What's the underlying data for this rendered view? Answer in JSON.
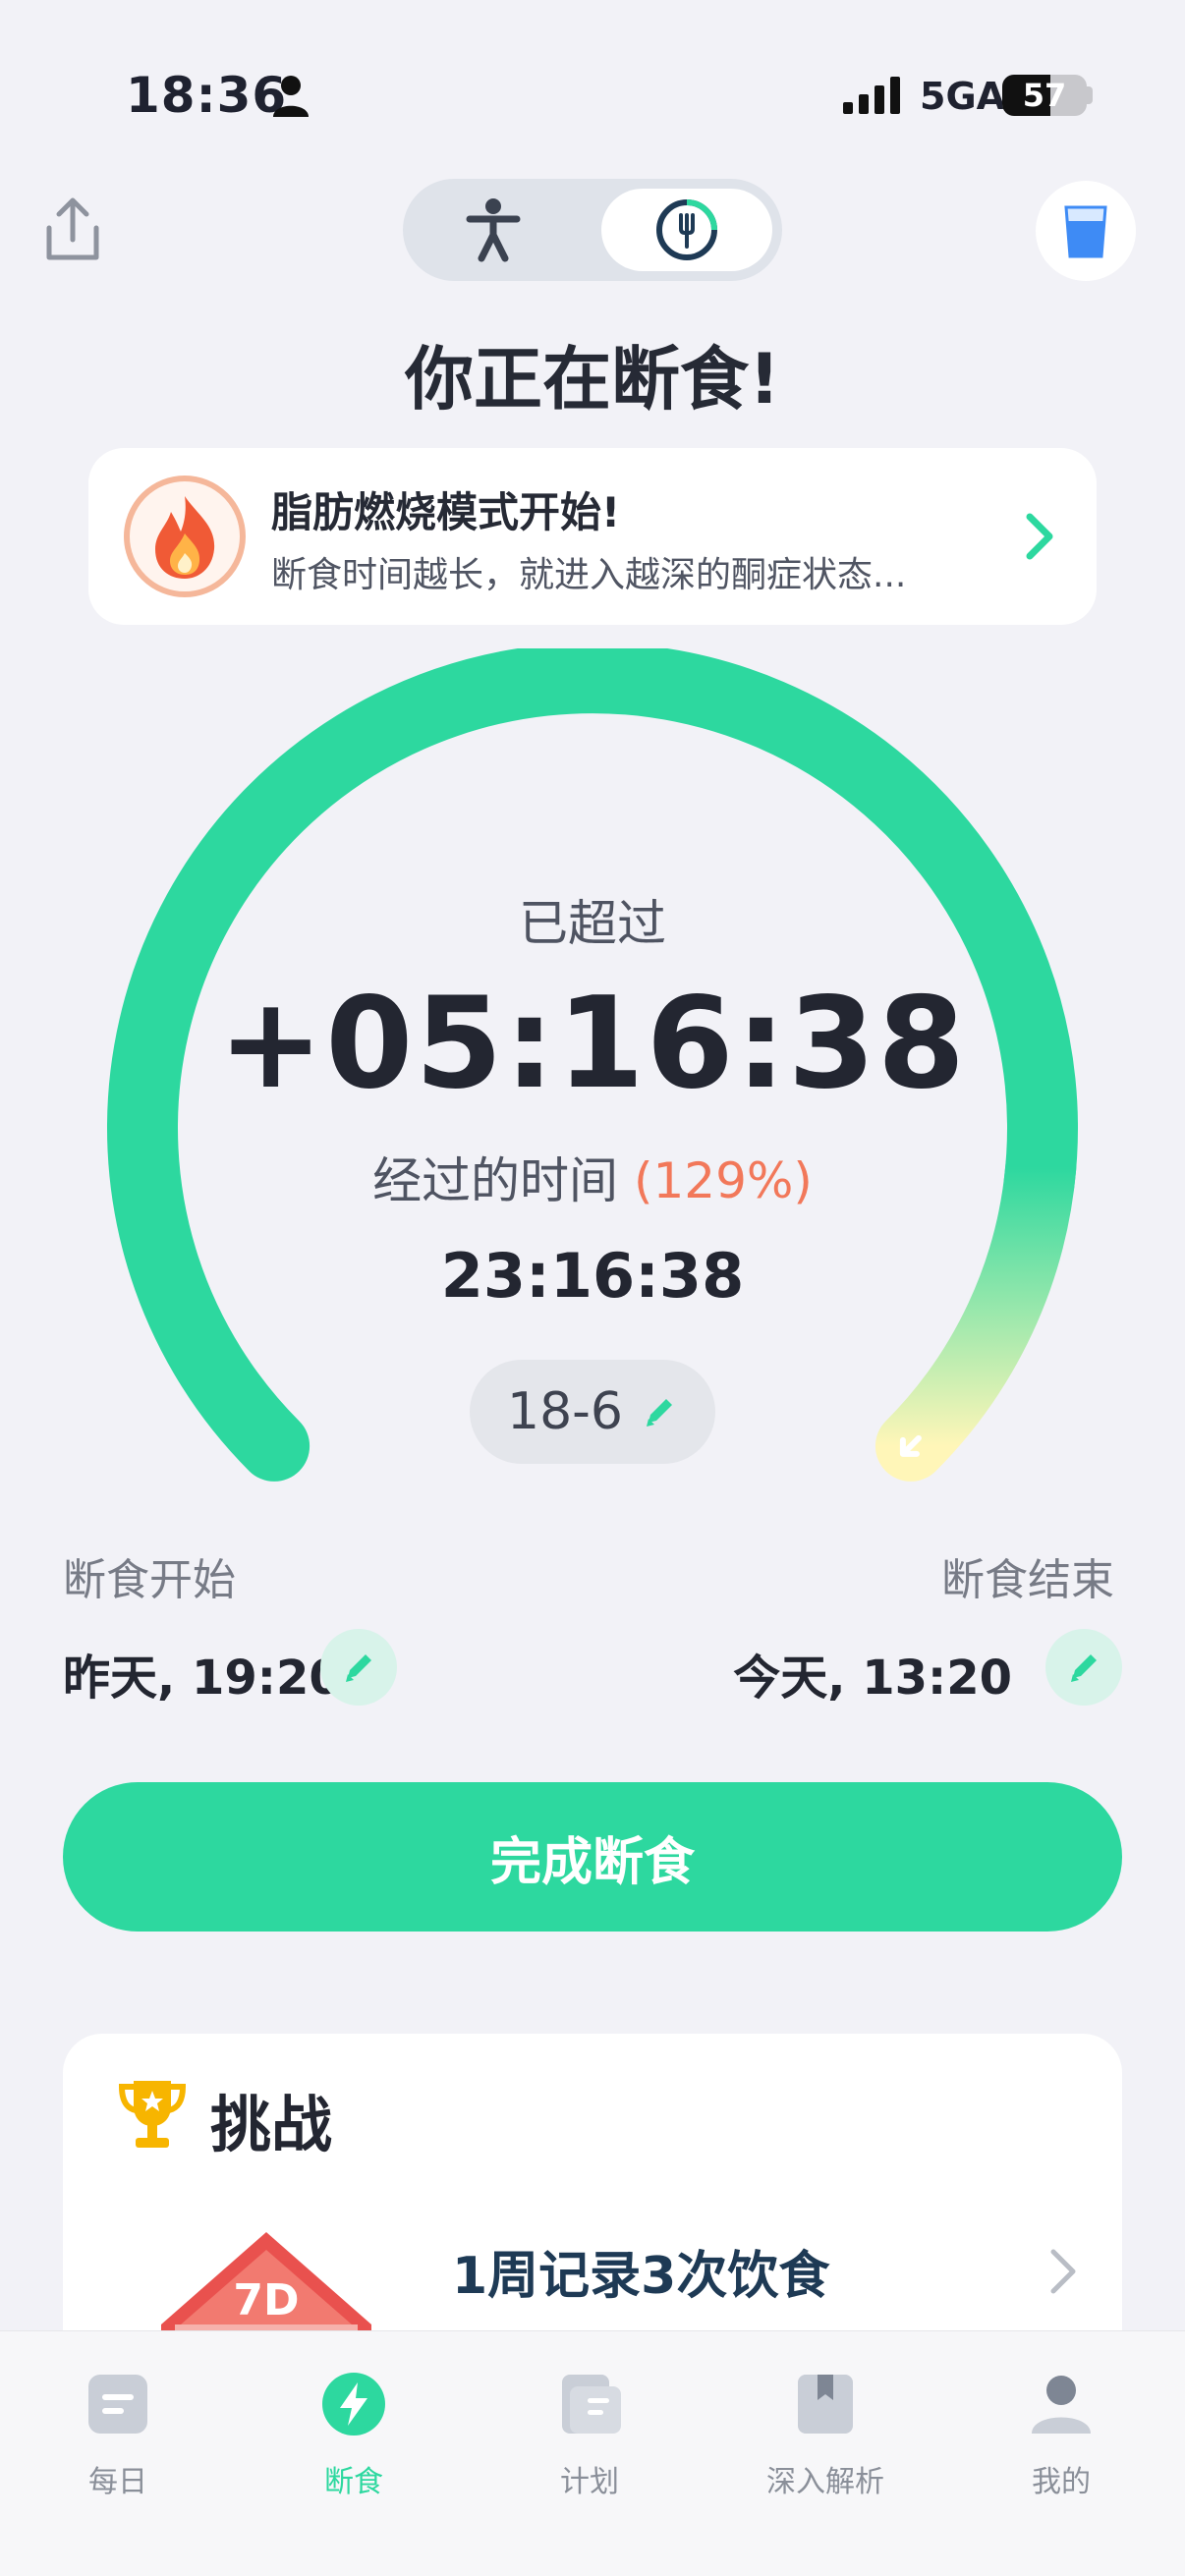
{
  "status_bar": {
    "time": "18:36",
    "network": "5GA",
    "battery": "57",
    "battery_level": 0.57
  },
  "top_nav": {
    "segment_left_icon": "accessibility-person-icon",
    "segment_right_icon": "fork-clock-icon",
    "share_icon": "share-upload-icon",
    "water_icon": "water-glass-icon"
  },
  "headline": "你正在断食!",
  "banner": {
    "icon": "flame-icon",
    "title": "脂肪燃烧模式开始!",
    "subtitle": "断食时间越长，就进入越深的酮症状态..."
  },
  "timer": {
    "caption": "已超过",
    "overtime": "+05:16:38",
    "elapsed_label": "经过的时间",
    "percent": "(129%)",
    "elapsed": "23:16:38",
    "plan": "18-6",
    "progress_fraction": 1.29
  },
  "fast_start": {
    "label": "断食开始",
    "value": "昨天, 19:20"
  },
  "fast_end": {
    "label": "断食结束",
    "value": "今天, 13:20"
  },
  "finish_button": "完成断食",
  "challenge": {
    "title": "挑战",
    "badge_text": "7D",
    "item": "1周记录3次饮食"
  },
  "tabs": [
    {
      "label": "每日",
      "icon": "daily-card-icon",
      "active": false
    },
    {
      "label": "断食",
      "icon": "lightning-icon",
      "active": true
    },
    {
      "label": "计划",
      "icon": "plan-list-icon",
      "active": false
    },
    {
      "label": "深入解析",
      "icon": "bookmark-book-icon",
      "active": false
    },
    {
      "label": "我的",
      "icon": "profile-icon",
      "active": false
    }
  ],
  "colors": {
    "accent": "#2DD89F",
    "accent_light": "#D8F3EA",
    "percent": "#F2785A",
    "background": "#F2F2F7"
  }
}
